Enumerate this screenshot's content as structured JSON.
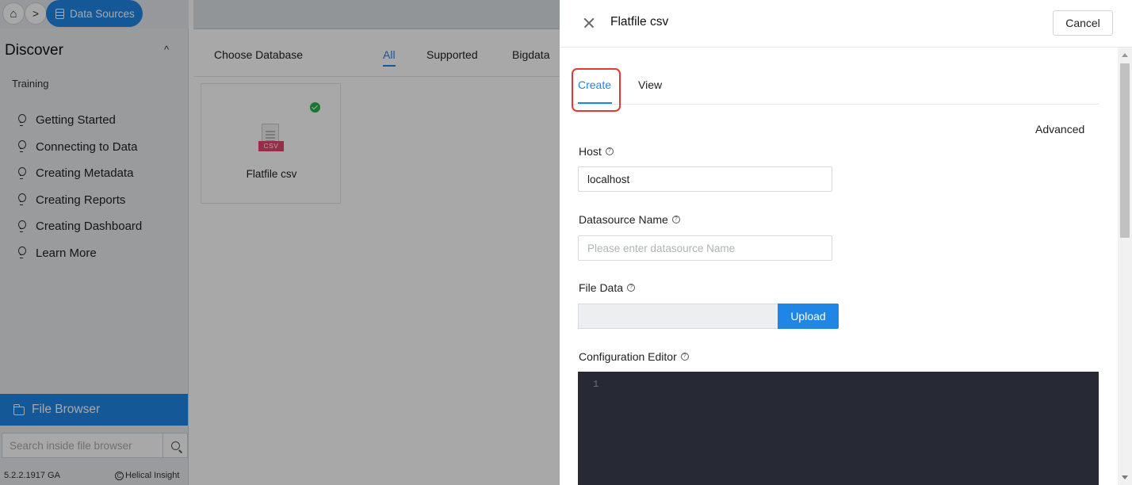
{
  "breadcrumb": {
    "home_icon": "home-icon",
    "separator": ">",
    "current": "Data Sources"
  },
  "sidebar": {
    "section_title": "Discover",
    "section_chevron": "^",
    "training_label": "Training",
    "training_items": [
      {
        "label": "Getting Started"
      },
      {
        "label": "Connecting to Data"
      },
      {
        "label": "Creating Metadata"
      },
      {
        "label": "Creating Reports"
      },
      {
        "label": "Creating Dashboard"
      },
      {
        "label": "Learn More"
      }
    ],
    "file_browser_label": "File Browser",
    "search_placeholder": "Search inside file browser",
    "version": "5.2.2.1917 GA",
    "brand": "Helical Insight",
    "brand_mark": "C"
  },
  "main": {
    "choose_title": "Choose Database",
    "filters": [
      "All",
      "Supported",
      "Bigdata"
    ],
    "cards": [
      {
        "name": "Flatfile csv",
        "tag": "CSV",
        "status": "supported"
      }
    ]
  },
  "drawer": {
    "title": "Flatfile csv",
    "cancel_label": "Cancel",
    "tabs": [
      {
        "label": "Create",
        "active": true
      },
      {
        "label": "View",
        "active": false
      }
    ],
    "advanced_label": "Advanced",
    "help_glyph": "?",
    "fields": {
      "host": {
        "label": "Host",
        "value": "localhost"
      },
      "datasource_name": {
        "label": "Datasource Name",
        "value": "",
        "placeholder": "Please enter datasource Name"
      },
      "file_data": {
        "label": "File Data",
        "value": "",
        "upload_label": "Upload"
      },
      "config_editor": {
        "label": "Configuration Editor",
        "line_numbers": "1"
      }
    }
  },
  "colors": {
    "accent": "#1f86e6",
    "highlight": "#e53935",
    "editor_bg": "#272935",
    "csv_tag": "#e2476b",
    "status_ok": "#2bb24c"
  }
}
